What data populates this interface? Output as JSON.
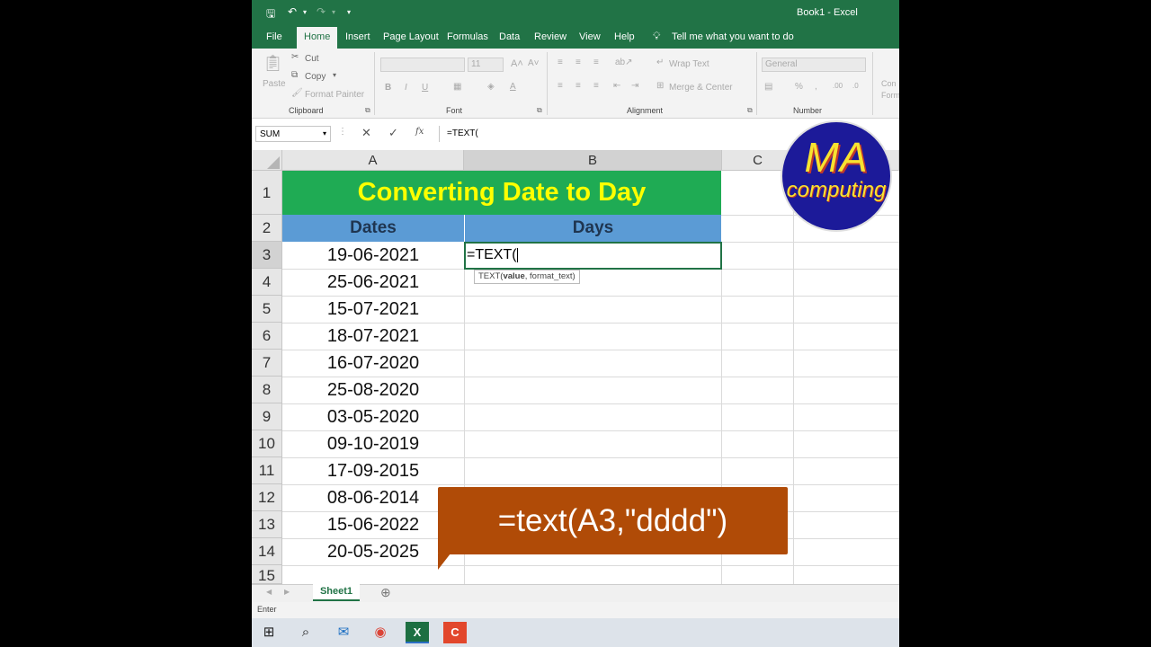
{
  "window": {
    "title": "Book1  -  Excel"
  },
  "tabs": [
    {
      "label": "File"
    },
    {
      "label": "Home"
    },
    {
      "label": "Insert"
    },
    {
      "label": "Page Layout"
    },
    {
      "label": "Formulas"
    },
    {
      "label": "Data"
    },
    {
      "label": "Review"
    },
    {
      "label": "View"
    },
    {
      "label": "Help"
    }
  ],
  "tell_me": "Tell me what you want to do",
  "ribbon": {
    "clipboard": {
      "paste": "Paste",
      "cut": "Cut",
      "copy": "Copy",
      "format_painter": "Format Painter",
      "label": "Clipboard"
    },
    "font": {
      "size": "11",
      "label": "Font"
    },
    "alignment": {
      "wrap": "Wrap Text",
      "merge": "Merge & Center",
      "label": "Alignment"
    },
    "number": {
      "format": "General",
      "label": "Number"
    },
    "styles": {
      "cond_line1": "Con",
      "cond_line2": "Form"
    }
  },
  "formula_bar": {
    "name_box": "SUM",
    "formula": "=TEXT(",
    "fx": "fx"
  },
  "columns": [
    "A",
    "B",
    "C"
  ],
  "rows": [
    "1",
    "2",
    "3",
    "4",
    "5",
    "6",
    "7",
    "8",
    "9",
    "10",
    "11",
    "12",
    "13",
    "14",
    "15"
  ],
  "sheet": {
    "title": "Converting Date to Day",
    "header_a": "Dates",
    "header_b": "Days",
    "dates": [
      "19-06-2021",
      "25-06-2021",
      "15-07-2021",
      "18-07-2021",
      "16-07-2020",
      "25-08-2020",
      "03-05-2020",
      "09-10-2019",
      "17-09-2015",
      "08-06-2014",
      "15-06-2022",
      "20-05-2025"
    ],
    "active_cell_text": "=TEXT(",
    "tooltip_fn": "TEXT(",
    "tooltip_arg1": "value",
    "tooltip_rest": ", format_text)"
  },
  "callout": "=text(A3,\"dddd\")",
  "logo": {
    "line1": "MA",
    "line2": "computing"
  },
  "sheet_tab": "Sheet1",
  "status": "Enter",
  "colors": {
    "excel_green": "#217346",
    "title_fill": "#1fab54",
    "title_text": "#ffff00",
    "header_fill": "#5b9bd5",
    "callout": "#b04b07"
  }
}
